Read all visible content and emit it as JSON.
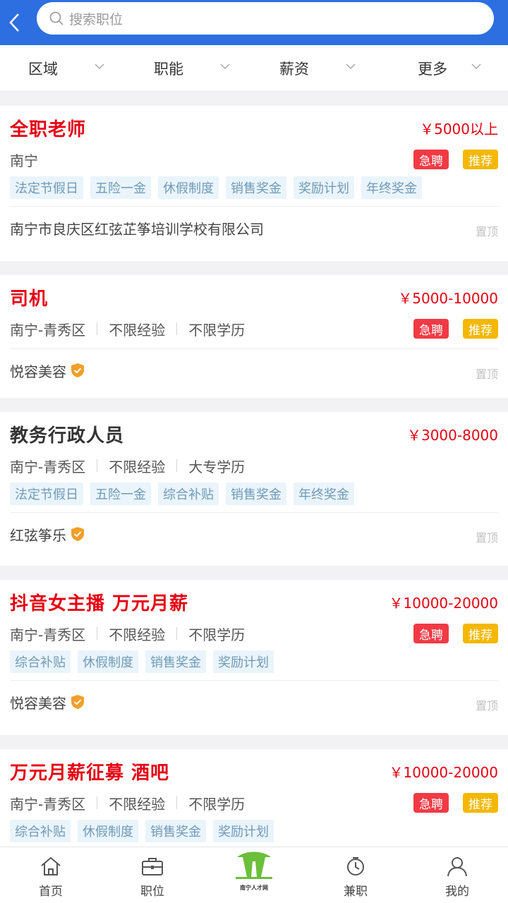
{
  "header": {
    "search_placeholder": "搜索职位",
    "accent": "#2d6fe0"
  },
  "filters": [
    {
      "label": "区域"
    },
    {
      "label": "职能"
    },
    {
      "label": "薪资"
    },
    {
      "label": "更多"
    }
  ],
  "jobs": [
    {
      "title": "全职老师",
      "salary": "￥5000以上",
      "location": "南宁",
      "experience": "",
      "education": "",
      "urgent": "急聘",
      "recommend": "推荐",
      "tags": [
        "法定节假日",
        "五险一金",
        "休假制度",
        "销售奖金",
        "奖励计划",
        "年终奖金"
      ],
      "company": "南宁市良庆区红弦芷筝培训学校有限公司",
      "verified": false,
      "pin": "置顶"
    },
    {
      "title": "司机",
      "salary": "￥5000-10000",
      "location": "南宁-青秀区",
      "experience": "不限经验",
      "education": "不限学历",
      "urgent": "急聘",
      "recommend": "推荐",
      "tags": [],
      "company": "悦容美容",
      "verified": true,
      "pin": "置顶"
    },
    {
      "title": "教务行政人员",
      "salary": "￥3000-8000",
      "location": "南宁-青秀区",
      "experience": "不限经验",
      "education": "大专学历",
      "urgent": "",
      "recommend": "",
      "tags": [
        "法定节假日",
        "五险一金",
        "综合补贴",
        "销售奖金",
        "年终奖金"
      ],
      "company": "红弦筝乐",
      "verified": true,
      "pin": "置顶"
    },
    {
      "title": "抖音女主播 万元月薪",
      "salary": "￥10000-20000",
      "location": "南宁-青秀区",
      "experience": "不限经验",
      "education": "不限学历",
      "urgent": "急聘",
      "recommend": "推荐",
      "tags": [
        "综合补贴",
        "休假制度",
        "销售奖金",
        "奖励计划"
      ],
      "company": "悦容美容",
      "verified": true,
      "pin": "置顶"
    },
    {
      "title": "万元月薪征募 酒吧",
      "salary": "￥10000-20000",
      "location": "南宁-青秀区",
      "experience": "不限经验",
      "education": "不限学历",
      "urgent": "急聘",
      "recommend": "推荐",
      "tags": [
        "综合补贴",
        "休假制度",
        "销售奖金",
        "奖励计划"
      ],
      "company": "",
      "verified": false,
      "pin": ""
    }
  ],
  "nav": {
    "home": "首页",
    "jobs": "职位",
    "logo": "南宁人才网",
    "parttime": "兼职",
    "mine": "我的"
  }
}
